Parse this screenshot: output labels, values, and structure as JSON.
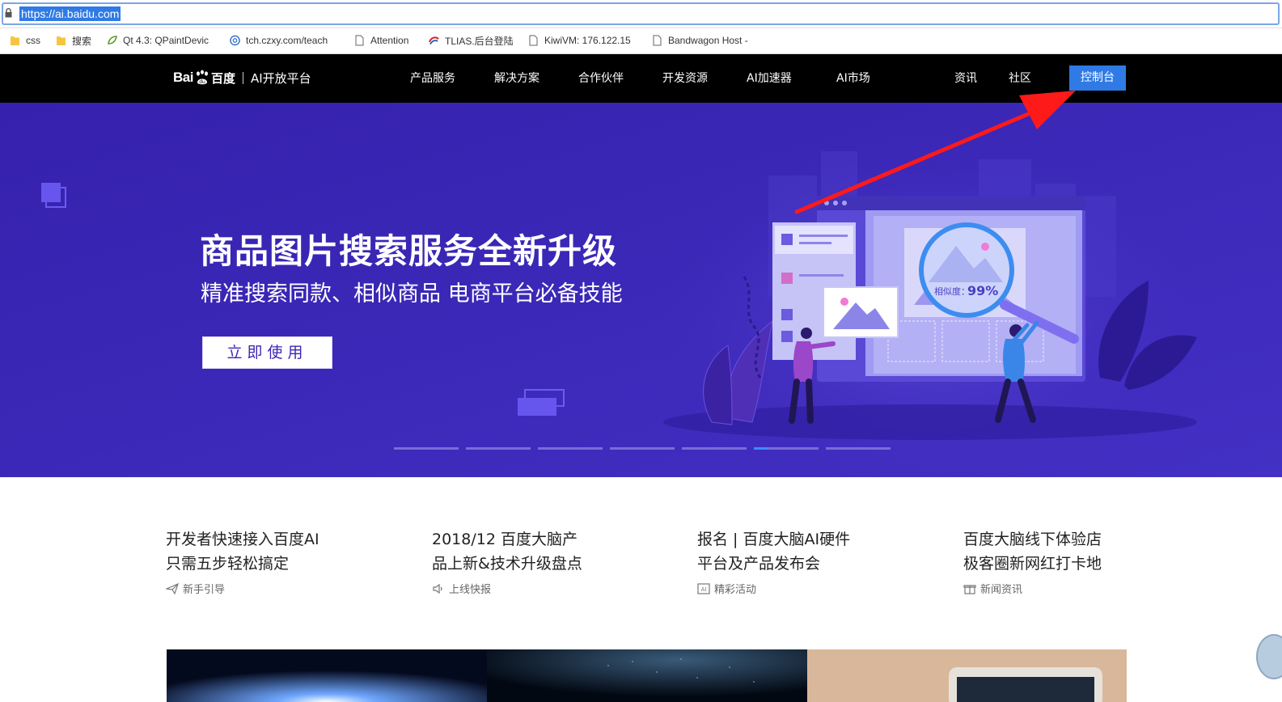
{
  "browser": {
    "url": "https://ai.baidu.com",
    "bookmarks": [
      {
        "label": "css",
        "icon": "folder-icon"
      },
      {
        "label": "搜索",
        "icon": "folder-icon"
      },
      {
        "label": "Qt 4.3: QPaintDevic",
        "icon": "qt-leaf-icon"
      },
      {
        "label": "tch.czxy.com/teach",
        "icon": "globe-icon"
      },
      {
        "label": "Attention",
        "icon": "page-icon"
      },
      {
        "label": "TLIAS.后台登陆",
        "icon": "tlias-logo-icon"
      },
      {
        "label": "KiwiVM: 176.122.15",
        "icon": "page-icon"
      },
      {
        "label": "Bandwagon Host -",
        "icon": "page-icon"
      }
    ]
  },
  "nav": {
    "logo_bai": "Bai",
    "logo_cn": "百度",
    "logo_sub": "AI开放平台",
    "items": [
      "产品服务",
      "解决方案",
      "合作伙伴",
      "开发资源",
      "AI加速器",
      "AI市场"
    ],
    "right_items": [
      "资讯",
      "社区"
    ],
    "console": "控制台"
  },
  "hero": {
    "title": "商品图片搜索服务全新升级",
    "subtitle": "精准搜索同款、相似商品  电商平台必备技能",
    "button": "立即使用",
    "similarity_label": "相似度：",
    "similarity_value": "99%",
    "slide_count": 7,
    "active_slide": 6
  },
  "news": [
    {
      "title_line1": "开发者快速接入百度AI",
      "title_line2": "只需五步轻松搞定",
      "tag": "新手引导",
      "icon": "paper-plane-icon"
    },
    {
      "title_line1": "2018/12 百度大脑产",
      "title_line2": "品上新&技术升级盘点",
      "tag": "上线快报",
      "icon": "speaker-icon"
    },
    {
      "title_line1": "报名 | 百度大脑AI硬件",
      "title_line2": "平台及产品发布会",
      "tag": "精彩活动",
      "icon": "ai-badge-icon"
    },
    {
      "title_line1": "百度大脑线下体验店",
      "title_line2": "极客圈新网红打卡地",
      "tag": "新闻资讯",
      "icon": "gift-icon"
    }
  ],
  "colors": {
    "hero_bg": "#3b26b5",
    "nav_bg": "#000000",
    "accent_blue": "#2f7ae5",
    "annotation_arrow": "#ff1a1a"
  }
}
